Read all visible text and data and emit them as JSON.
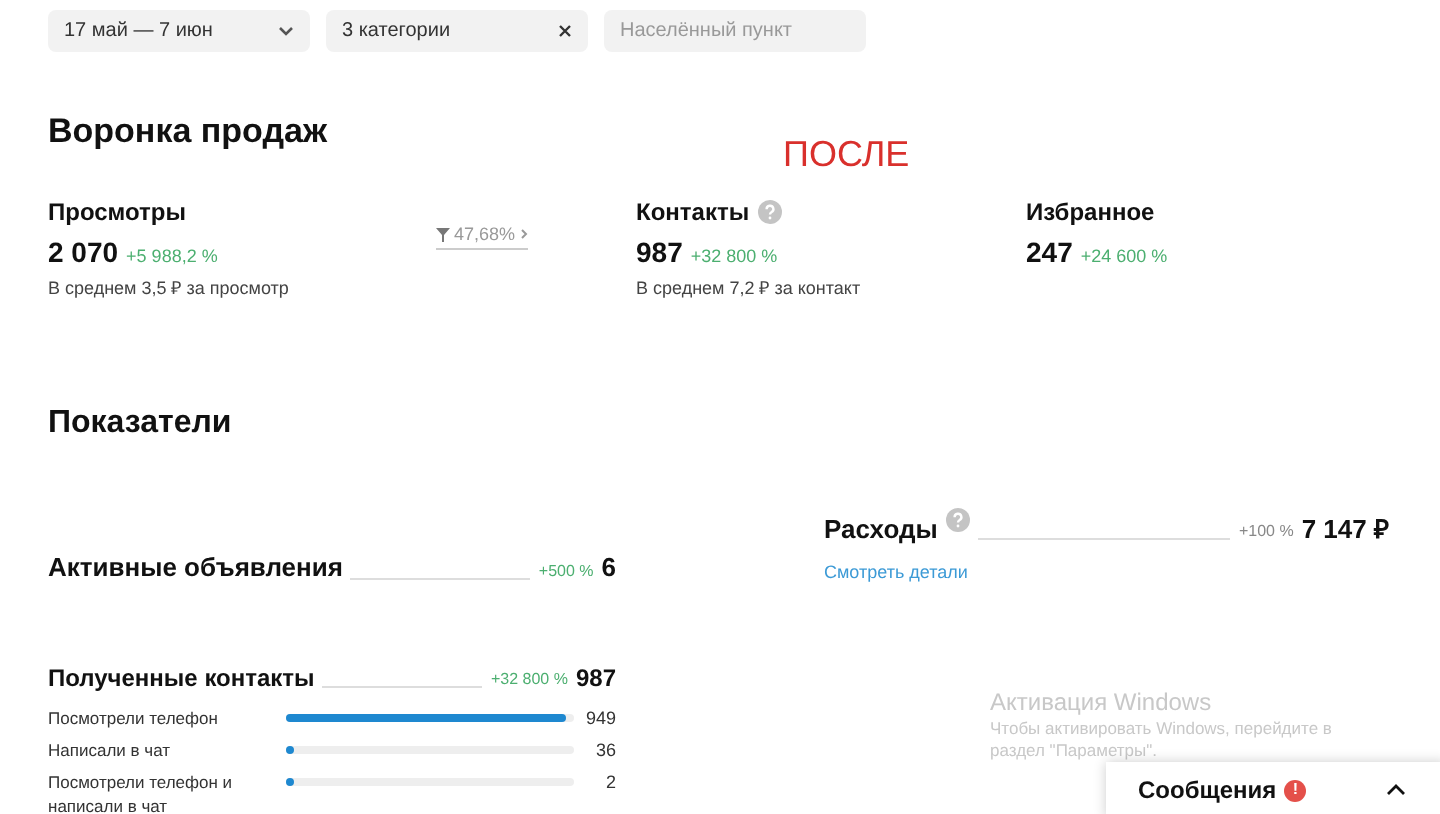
{
  "filters": [
    {
      "kind": "dropdown",
      "value": "17 май — 7 июн"
    },
    {
      "kind": "clearable",
      "value": "3 категории"
    },
    {
      "kind": "input",
      "placeholder": "Населённый пункт"
    }
  ],
  "funnel": {
    "title": "Воронка продаж",
    "stamp": "ПОСЛЕ",
    "metrics": [
      {
        "label": "Просмотры",
        "help": false,
        "value": "2 070",
        "change": "+5 988,2 %",
        "note": "В среднем 3,5 ₽ за просмотр",
        "conversion": "47,68%"
      },
      {
        "label": "Контакты",
        "help": true,
        "value": "987",
        "change": "+32 800 %",
        "note": "В среднем 7,2 ₽ за контакт"
      },
      {
        "label": "Избранное",
        "help": false,
        "value": "247",
        "change": "+24 600 %"
      }
    ]
  },
  "indicators": {
    "title": "Показатели",
    "active": {
      "label": "Активные объявления",
      "change": "+500 %",
      "value": "6"
    },
    "expenses": {
      "label": "Расходы",
      "change": "+100 %",
      "value": "7 147 ₽",
      "link": "Смотреть детали"
    },
    "contacts": {
      "label": "Полученные контакты",
      "change": "+32 800 %",
      "value": "987",
      "rows": [
        {
          "label": "Посмотрели телефон",
          "level": 0.97,
          "value": "949"
        },
        {
          "label": "Написали в чат",
          "level": 0.03,
          "value": "36"
        },
        {
          "label": "Посмотрели телефон и написали в чат",
          "level": 0.015,
          "value": "2"
        }
      ]
    }
  },
  "windows_notice": {
    "title": "Активация Windows",
    "text": "Чтобы активировать Windows, перейдите в раздел \"Параметры\"."
  },
  "messages": {
    "label": "Сообщения",
    "badge": "!"
  }
}
